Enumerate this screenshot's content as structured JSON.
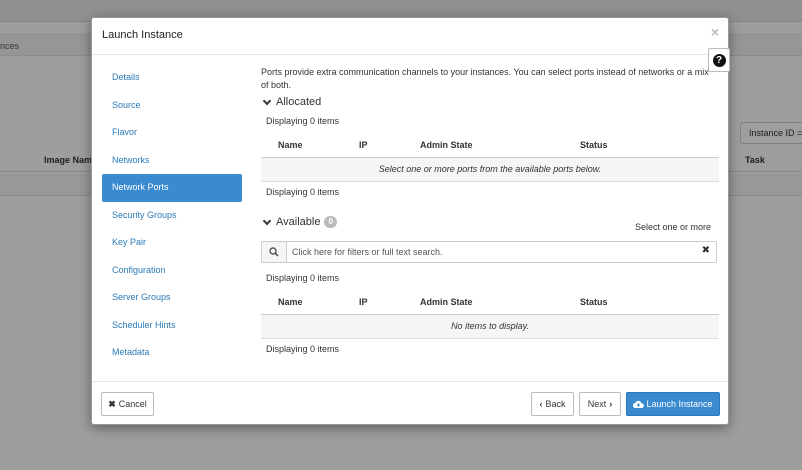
{
  "background": {
    "breadcrumb": "nces",
    "filter_label": "Instance ID =",
    "columns": {
      "image_name": "Image Name",
      "task": "Task"
    }
  },
  "modal": {
    "title": "Launch Instance",
    "close_icon": "×",
    "help_icon": "?",
    "nav": [
      {
        "label": "Details"
      },
      {
        "label": "Source"
      },
      {
        "label": "Flavor"
      },
      {
        "label": "Networks"
      },
      {
        "label": "Network Ports",
        "active": true
      },
      {
        "label": "Security Groups"
      },
      {
        "label": "Key Pair"
      },
      {
        "label": "Configuration"
      },
      {
        "label": "Server Groups"
      },
      {
        "label": "Scheduler Hints"
      },
      {
        "label": "Metadata"
      }
    ],
    "intro": "Ports provide extra communication channels to your instances. You can select ports instead of networks or a mix of both.",
    "allocated": {
      "title": "Allocated",
      "displaying_top": "Displaying 0 items",
      "columns": {
        "name": "Name",
        "ip": "IP",
        "admin_state": "Admin State",
        "status": "Status"
      },
      "empty_text": "Select one or more ports from the available ports below.",
      "displaying_bottom": "Displaying 0 items"
    },
    "available": {
      "title": "Available",
      "count": "0",
      "hint": "Select one or more",
      "search_placeholder": "Click here for filters or full text search.",
      "search_clear": "✖",
      "displaying_top": "Displaying 0 items",
      "columns": {
        "name": "Name",
        "ip": "IP",
        "admin_state": "Admin State",
        "status": "Status"
      },
      "empty_text": "No items to display.",
      "displaying_bottom": "Displaying 0 items"
    },
    "footer": {
      "cancel": "Cancel",
      "back": "Back",
      "next": "Next",
      "launch": "Launch Instance"
    }
  },
  "colors": {
    "primary": "#3a8ad0",
    "link": "#2a7ab8",
    "badge": "#bbbbbb"
  }
}
